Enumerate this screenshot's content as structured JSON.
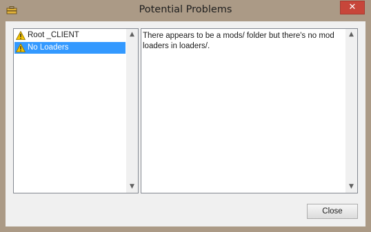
{
  "window": {
    "title": "Potential Problems",
    "close_glyph": "✕"
  },
  "problems_list": {
    "items": [
      {
        "label": "Root _CLIENT",
        "icon": "warning-icon",
        "selected": false
      },
      {
        "label": "No Loaders",
        "icon": "warning-icon",
        "selected": true
      }
    ],
    "scroll_up_glyph": "▲",
    "scroll_down_glyph": "▼"
  },
  "details": {
    "text": "There appears to be a mods/ folder but there's no mod loaders in loaders/.",
    "scroll_up_glyph": "▲",
    "scroll_down_glyph": "▼"
  },
  "footer": {
    "close_label": "Close"
  },
  "colors": {
    "frame": "#ab9a86",
    "selection": "#3399ff",
    "close_button": "#c7463a",
    "warning": "#f5c400"
  }
}
